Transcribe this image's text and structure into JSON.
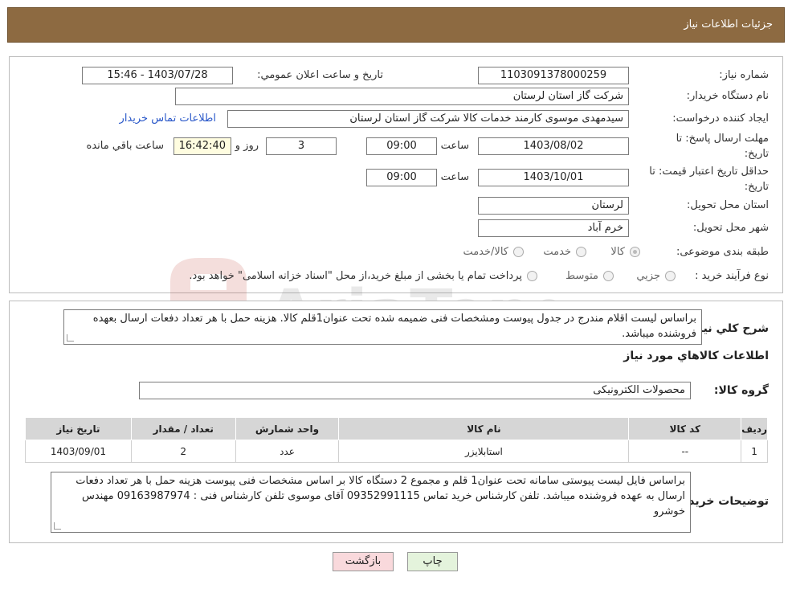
{
  "header": {
    "title": "جزئیات اطلاعات نیاز"
  },
  "form": {
    "need_number_label": "شماره نیاز:",
    "need_number": "1103091378000259",
    "announce_label": "تاریخ و ساعت اعلان عمومي:",
    "announce_value": "1403/07/28 - 15:46",
    "buyer_org_label": "نام دستگاه خريدار:",
    "buyer_org": "شرکت گاز استان لرستان",
    "requester_label": "ايجاد کننده درخواست:",
    "requester": "سیدمهدی موسوی کارمند خدمات کالا شرکت گاز استان لرستان",
    "contact_link": "اطلاعات تماس خريدار",
    "deadline_label_1": "مهلت ارسال پاسخ: تا",
    "deadline_label_2": "تاريخ:",
    "deadline_date": "1403/08/02",
    "time_word": "ساعت",
    "deadline_time": "09:00",
    "days_value": "3",
    "days_word": "روز و",
    "remaining_time": "16:42:40",
    "remaining_word": "ساعت باقي مانده",
    "validity_label_1": "حداقل تاريخ اعتبار قيمت: تا",
    "validity_label_2": "تاريخ:",
    "validity_date": "1403/10/01",
    "validity_time": "09:00",
    "province_label": "استان محل تحويل:",
    "province": "لرستان",
    "city_label": "شهر محل تحويل:",
    "city": "خرم آباد",
    "category_label": "طبقه بندی موضوعی:",
    "category_options": [
      "کالا",
      "خدمت",
      "کالا/خدمت"
    ],
    "process_label": "نوع فرآيند خريد :",
    "process_options": [
      "جزيي",
      "متوسط"
    ],
    "process_note": "پرداخت تمام یا بخشی از مبلغ خرید،از محل \"اسناد خزانه اسلامی\" خواهد بود."
  },
  "details": {
    "summary_label": "شرح کلي نياز:",
    "summary_text": "براساس لیست اقلام مندرج در جدول پیوست ومشخصات فنی ضمیمه شده تحت عنوان1قلم کالا. هزینه حمل با هر تعداد دفعات ارسال بعهده فروشنده میباشد.",
    "items_title": "اطلاعات کالاهاي مورد نياز",
    "group_label": "گروه کالا:",
    "group_value": "محصولات الکترونیکی",
    "table_headers": [
      "رديف",
      "کد کالا",
      "نام کالا",
      "واحد شمارش",
      "تعداد / مقدار",
      "تاريخ نياز"
    ],
    "table_rows": [
      [
        "1",
        "--",
        "استابلایزر",
        "عدد",
        "2",
        "1403/09/01"
      ]
    ],
    "buyer_notes_label": "توضيحات خريدار:",
    "buyer_notes": "براساس  فایل لیست پیوستی سامانه تحت عنوان1 قلم و مجموع 2 دستگاه کالا بر اساس مشخصات فنی پیوست هزینه حمل با هر تعداد دفعات ارسال به عهده فروشنده میباشد. تلفن کارشناس خرید تماس 09352991115 آقای موسوی تلفن کارشناس فنی : 09163987974 مهندس خوشرو"
  },
  "buttons": {
    "print": "چاپ",
    "back": "بازگشت"
  }
}
